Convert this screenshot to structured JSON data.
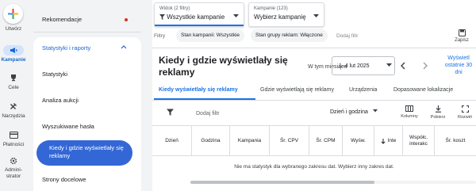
{
  "rail": {
    "create_label": "Utwórz",
    "items": [
      {
        "label": "Kampanie",
        "icon": "megaphone-icon",
        "active": true
      },
      {
        "label": "Cele",
        "icon": "trophy-icon"
      },
      {
        "label": "Narzędzia",
        "icon": "tools-icon"
      },
      {
        "label": "Płatności",
        "icon": "credit-card-icon"
      },
      {
        "label": "Admini-\nstrator",
        "icon": "gear-icon"
      }
    ]
  },
  "nav": {
    "recommendations": "Rekomendacje",
    "group_title": "Statystyki i raporty",
    "items": [
      "Statystyki",
      "Analiza aukcji",
      "Wyszukiwane hasła",
      "Kiedy i gdzie wyświetlały się reklamy",
      "Strony docelowe"
    ]
  },
  "header": {
    "view_dropdown": {
      "label": "Widok (2 filtry)",
      "value": "Wszystkie kampanie"
    },
    "campaign_dropdown": {
      "label": "Kampanie (123)",
      "value": "Wybierz kampanię"
    },
    "filters_label": "Filtry",
    "chips": [
      "Stan kampanii: Wszystkie",
      "Stan grupy reklam: Włączone"
    ],
    "add_filter": "Dodaj filtr",
    "save_label": "Zapisz"
  },
  "page": {
    "title": "Kiedy i gdzie wyświetlały się reklamy",
    "period_label": "W tym miesiącu",
    "date_range": "1–4 lut 2025",
    "last30": "Wyświetl ostatnie 30 dni"
  },
  "tabs": [
    "Kiedy wyświetlały się reklamy",
    "Gdzie wyświetlają się reklamy",
    "Urządzenia",
    "Dopasowane lokalizacje"
  ],
  "toolbar": {
    "add_filter": "Dodaj filtr",
    "segment": "Dzień i godzina",
    "columns": "Kolumny",
    "download": "Pobierz",
    "expand": "Rozwiń"
  },
  "table": {
    "columns": [
      "Dzień",
      "Godzina",
      "Kampania",
      "Śr. CPV",
      "Śr. CPM",
      "Wyśw.",
      "Inte",
      "Współc. interakc",
      "Śr. koszt"
    ],
    "empty_message": "Nie ma statystyk dla wybranego zakresu dat. Wybierz inny zakres dat."
  },
  "colors": {
    "accent": "#1a73e8",
    "selected_nav": "#3367d6",
    "alert_dot": "#d93025"
  }
}
